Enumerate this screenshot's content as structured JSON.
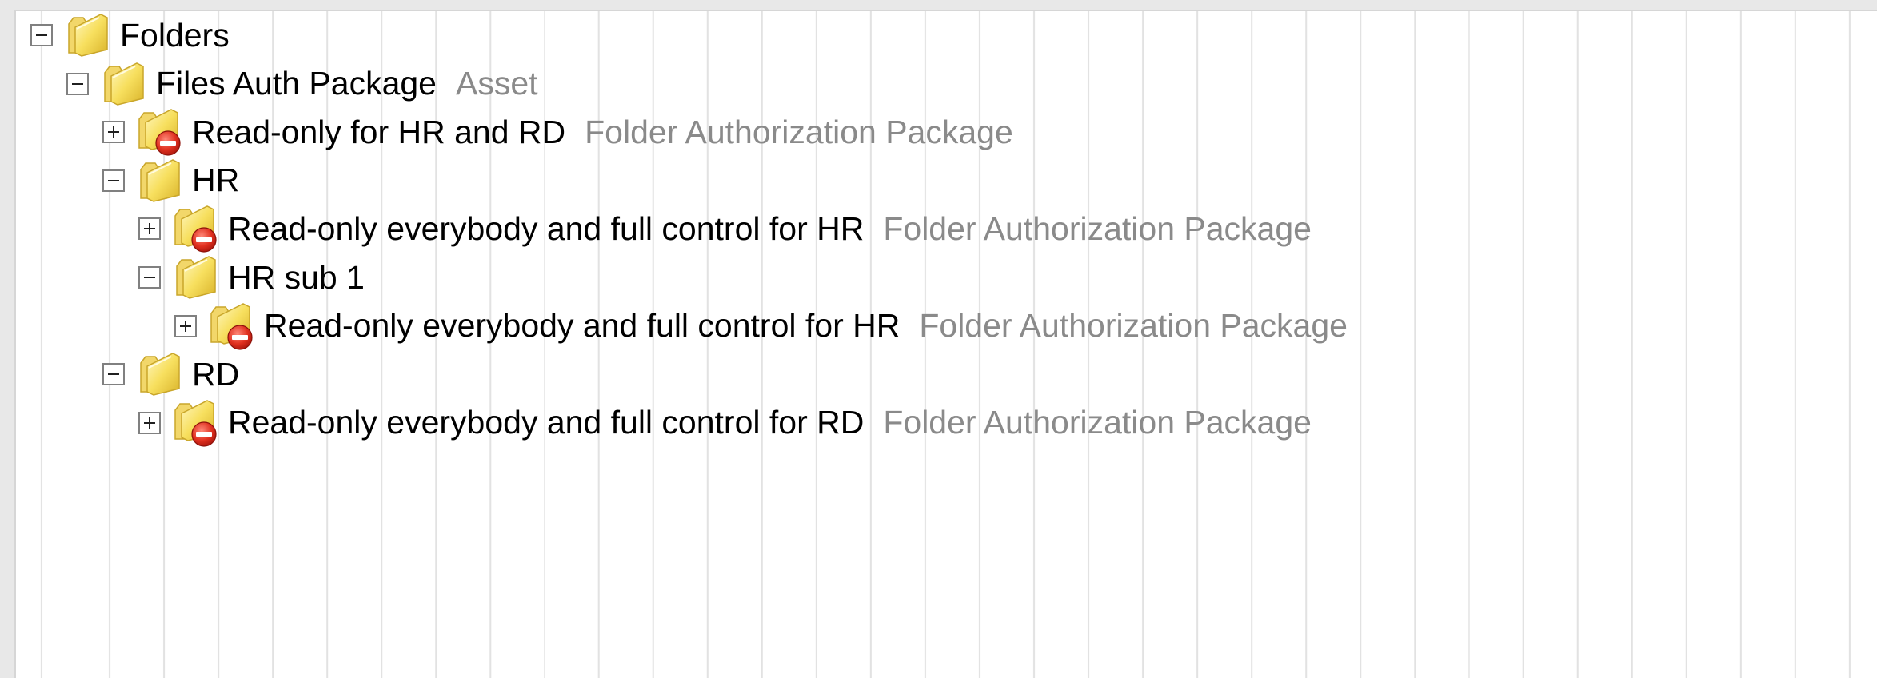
{
  "tree": {
    "nodes": [
      {
        "label": "Folders",
        "type": "",
        "expanded": true,
        "icon": "folder-icon",
        "depth": 0
      },
      {
        "label": "Files Auth Package",
        "type": "Asset",
        "expanded": true,
        "icon": "folder-icon",
        "depth": 1
      },
      {
        "label": "Read-only for HR and RD",
        "type": "Folder Authorization Package",
        "expanded": false,
        "icon": "restricted-folder-icon",
        "depth": 2
      },
      {
        "label": "HR",
        "type": "",
        "expanded": true,
        "icon": "folder-icon",
        "depth": 2
      },
      {
        "label": "Read-only everybody and full control for HR",
        "type": "Folder Authorization Package",
        "expanded": false,
        "icon": "restricted-folder-icon",
        "depth": 3
      },
      {
        "label": "HR sub 1",
        "type": "",
        "expanded": true,
        "icon": "folder-icon",
        "depth": 3
      },
      {
        "label": "Read-only everybody and full control for HR",
        "type": "Folder Authorization Package",
        "expanded": false,
        "icon": "restricted-folder-icon",
        "depth": 4
      },
      {
        "label": "RD",
        "type": "",
        "expanded": true,
        "icon": "folder-icon",
        "depth": 2
      },
      {
        "label": "Read-only everybody and full control for RD",
        "type": "Folder Authorization Package",
        "expanded": false,
        "icon": "restricted-folder-icon",
        "depth": 3
      }
    ]
  },
  "colors": {
    "label": "#000000",
    "type": "#8a8a8a",
    "folder": "#f5d94a",
    "restricted": "#d9271c"
  }
}
